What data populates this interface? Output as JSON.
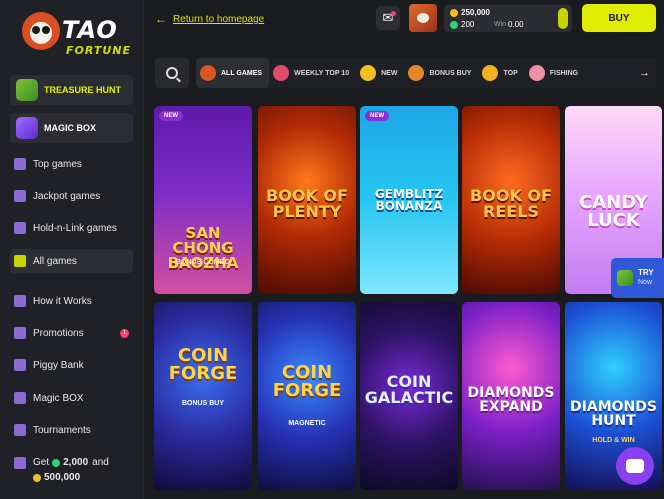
{
  "logo": {
    "line1": "TAO",
    "line2": "FORTUNE"
  },
  "sidebar": {
    "promos": [
      {
        "label": "TREASURE HUNT",
        "icon": "treasure-hunt-icon"
      },
      {
        "label": "MAGIC BOX",
        "icon": "magic-box-icon"
      }
    ],
    "items": [
      {
        "label": "Top games",
        "icon": "crown-icon"
      },
      {
        "label": "Jackpot games",
        "icon": "diamond-icon"
      },
      {
        "label": "Hold-n-Link games",
        "icon": "link-icon"
      },
      {
        "label": "All games",
        "icon": "slot-icon",
        "active": true
      },
      {
        "label": "How it Works",
        "icon": "info-icon"
      },
      {
        "label": "Promotions",
        "icon": "promo-icon",
        "badge": "1"
      },
      {
        "label": "Piggy Bank",
        "icon": "piggy-icon"
      },
      {
        "label": "Magic BOX",
        "icon": "box-icon"
      },
      {
        "label": "Tournaments",
        "icon": "tournament-icon"
      }
    ],
    "bonus": {
      "prefix": "Get",
      "gold": "2,000",
      "and": "and",
      "sweeps": "500,000"
    }
  },
  "header": {
    "back_label": "Return to homepage",
    "balance_gold": "250,000",
    "balance_sweeps": "200",
    "win_label": "Win",
    "win_value": "0.00",
    "buy_label": "BUY"
  },
  "categories": [
    {
      "label": "ALL GAMES",
      "active": true,
      "color": "#d9561f"
    },
    {
      "label": "WEEKLY TOP 10",
      "color": "#e24b6b"
    },
    {
      "label": "NEW",
      "color": "#f2c01c"
    },
    {
      "label": "BONUS BUY",
      "color": "#e5862b"
    },
    {
      "label": "TOP",
      "color": "#f2b21c"
    },
    {
      "label": "FISHING",
      "color": "#ee8fa8"
    }
  ],
  "games": [
    {
      "name": "SAN CHONG BAOZHA",
      "sub": "BONUS COMBO",
      "new": true
    },
    {
      "name": "BOOK OF PLENTY",
      "sub": ""
    },
    {
      "name": "GEMBLITZ BONANZA",
      "sub": "",
      "new": true
    },
    {
      "name": "BOOK OF REELS",
      "sub": ""
    },
    {
      "name": "CANDY LUCK",
      "sub": ""
    },
    {
      "name": "COIN FORGE",
      "sub": "BONUS BUY"
    },
    {
      "name": "COIN FORGE",
      "sub": "MAGNETIC"
    },
    {
      "name": "COIN GALACTIC",
      "sub": ""
    },
    {
      "name": "DIAMONDS EXPAND",
      "sub": ""
    },
    {
      "name": "DIAMONDS HUNT",
      "sub": "HOLD & WIN"
    }
  ],
  "new_label": "NEW",
  "try_widget": {
    "title": "TRY",
    "sub": "Now"
  }
}
